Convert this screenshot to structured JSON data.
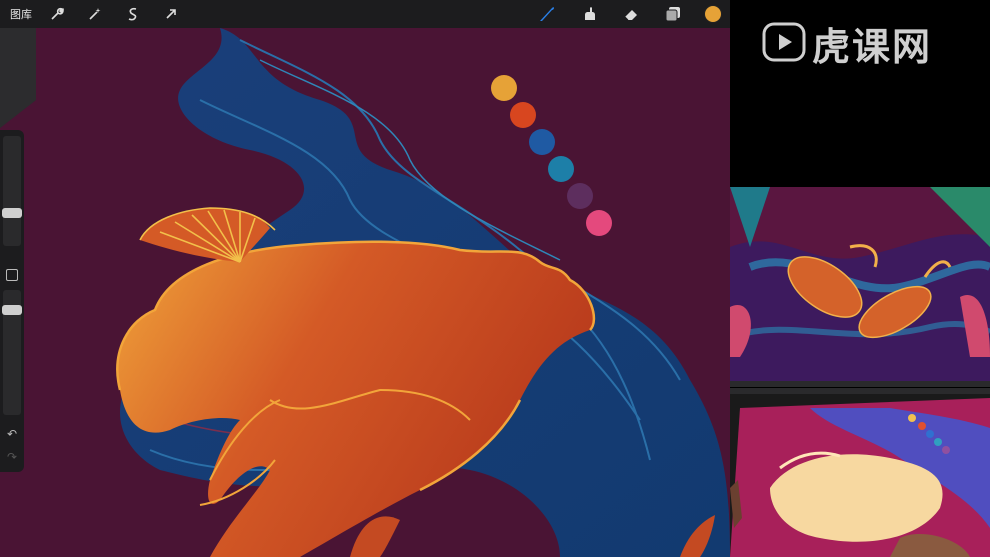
{
  "toolbar": {
    "gallery_label": "图库",
    "left_icons": [
      "wrench-icon",
      "magic-wand-icon",
      "selection-icon",
      "transform-arrow-icon"
    ],
    "right_icons": [
      "brush-icon",
      "smudge-icon",
      "eraser-icon",
      "layers-icon"
    ],
    "current_color": "#e6a237"
  },
  "palette": {
    "swatches": [
      "#e6a237",
      "#d8461f",
      "#1f5aa3",
      "#1d7fa8",
      "#5d2e5e",
      "#e4497d"
    ]
  },
  "logo": {
    "text": "虎课网"
  },
  "sidebar": {
    "undo_symbol": "↶",
    "redo_symbol": "↷"
  }
}
